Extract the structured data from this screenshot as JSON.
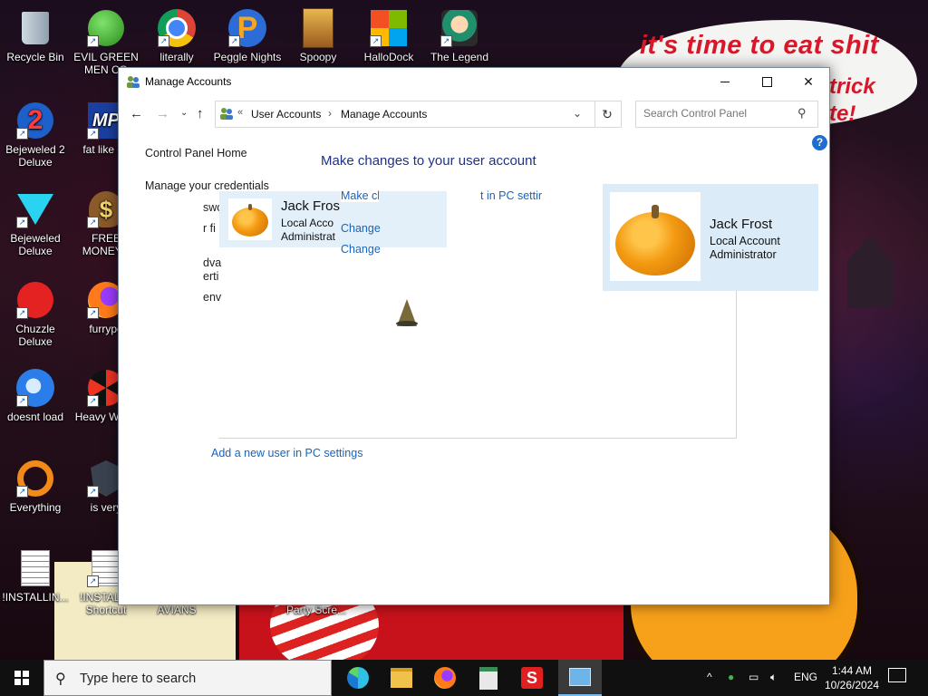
{
  "wallpaper": {
    "caption_line1": "it's time to eat shit",
    "caption_line2": "trick",
    "caption_line3": "te!"
  },
  "desktop_icons": [
    {
      "label": "Recycle Bin",
      "icon": "recycle-bin-icon"
    },
    {
      "label": "EVIL GREEN MEN CO",
      "icon": "people-icon"
    },
    {
      "label": "literally",
      "icon": "chrome-icon"
    },
    {
      "label": "Peggle Nights",
      "icon": "peggle-icon"
    },
    {
      "label": "Spoopy",
      "icon": "folder-icon"
    },
    {
      "label": "HalloDock",
      "icon": "windows-logo-icon"
    },
    {
      "label": "The Legend",
      "icon": "character-icon"
    },
    {
      "label": "Bejeweled 2 Deluxe",
      "icon": "bejeweled-2-icon"
    },
    {
      "label": "fat like da",
      "icon": "mp-game-icon"
    },
    {
      "label": "Bejeweled Deluxe",
      "icon": "gem-icon"
    },
    {
      "label": "FREE MONEY.e",
      "icon": "money-bag-icon"
    },
    {
      "label": "Chuzzle Deluxe",
      "icon": "chuzzle-icon"
    },
    {
      "label": "furrypo",
      "icon": "firefox-icon"
    },
    {
      "label": "doesnt load",
      "icon": "thunderbird-icon"
    },
    {
      "label": "Heavy Weap",
      "icon": "radiation-icon"
    },
    {
      "label": "Everything",
      "icon": "search-ring-icon"
    },
    {
      "label": "is very",
      "icon": "shield-icon"
    },
    {
      "label": "!INSTALLIN...",
      "icon": "document-icon"
    },
    {
      "label": "!INSTALL - Shortcut",
      "icon": "document-icon"
    },
    {
      "label": "AVIANS",
      "icon": "document-icon"
    },
    {
      "label": "Party Scre...",
      "icon": "document-icon"
    }
  ],
  "window": {
    "title": "Manage Accounts",
    "breadcrumb": {
      "chevron": "«",
      "crumb1": "User Accounts",
      "sep": "›",
      "crumb2": "Manage Accounts"
    },
    "search_placeholder": "Search Control Panel",
    "help": "?",
    "nav": {
      "home": "Control Panel Home",
      "credentials": "Manage your credentials"
    },
    "heading": "Make changes to your user account",
    "ghost_left": [
      "swo",
      "r fi",
      "dva",
      "erti",
      "env"
    ],
    "ghost_card": {
      "name": "Jack Fros",
      "type": "Local Acco",
      "role": "Administrat"
    },
    "ghost_links": {
      "make_head": "Make ch",
      "make_tail": "t in PC settir",
      "change1": "Change",
      "change2": "Change"
    },
    "user": {
      "name": "Jack Frost",
      "type": "Local Account",
      "role": "Administrator"
    },
    "add_user": "Add a new user in PC settings"
  },
  "taskbar": {
    "search_text": "Type here to search",
    "apps": [
      "edge-icon",
      "file-explorer-icon",
      "firefox-icon",
      "calculator-icon",
      "app-s-icon",
      "control-panel-icon"
    ],
    "lang": "ENG",
    "time": "1:44 AM",
    "date": "10/26/2024"
  },
  "colors": {
    "link": "#1a64b8",
    "heading": "#1e3287",
    "card": "#dcebf8",
    "accent": "#1e6ed1"
  }
}
